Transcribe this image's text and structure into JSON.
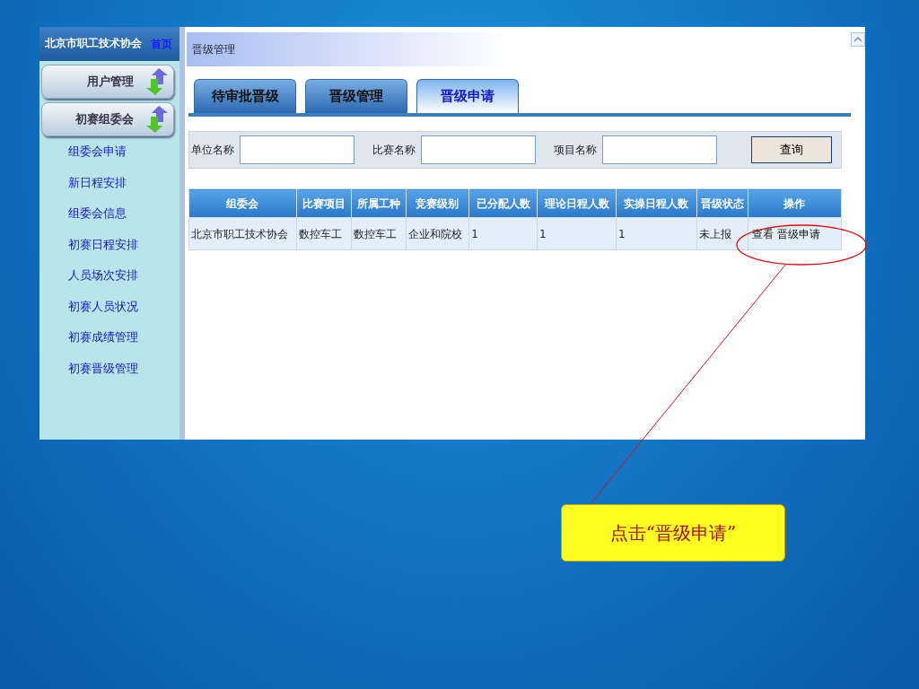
{
  "sidebar": {
    "title": "北京市职工技术协会",
    "home_link": "首页",
    "groups": [
      {
        "label": "用户管理"
      },
      {
        "label": "初赛组委会",
        "items": [
          "组委会申请",
          "新日程安排",
          "组委会信息",
          "初赛日程安排",
          "人员场次安排",
          "初赛人员状况",
          "初赛成绩管理",
          "初赛晋级管理"
        ]
      }
    ]
  },
  "main": {
    "title": "晋级管理",
    "tabs": [
      {
        "label": "待审批晋级",
        "selected": false
      },
      {
        "label": "晋级管理",
        "selected": false
      },
      {
        "label": "晋级申请",
        "selected": true
      }
    ],
    "filters": [
      {
        "label": "单位名称"
      },
      {
        "label": "比赛名称"
      },
      {
        "label": "项目名称"
      }
    ],
    "query_button": "查询",
    "table": {
      "columns": [
        "组委会",
        "比赛项目",
        "所属工种",
        "竞赛级别",
        "已分配人数",
        "理论日程人数",
        "实操日程人数",
        "晋级状态",
        "操作"
      ],
      "rows": [
        {
          "cells": [
            "北京市职工技术协会",
            "数控车工",
            "数控车工",
            "企业和院校",
            "1",
            "1",
            "1",
            "未上报"
          ],
          "actions": [
            "查看",
            "晋级申请"
          ]
        }
      ]
    }
  },
  "callout": {
    "text": "点击“晋级申请”"
  }
}
